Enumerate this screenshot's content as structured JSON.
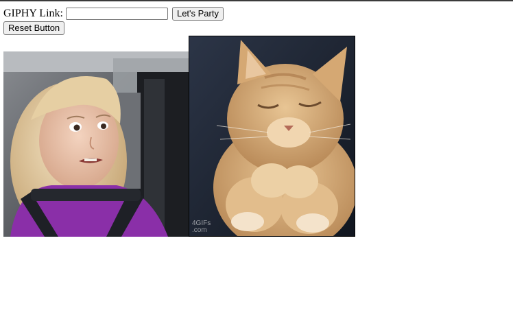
{
  "form": {
    "label": "GIPHY Link:",
    "input_value": "",
    "input_placeholder": "",
    "party_button": "Let's Party",
    "reset_button": "Reset Button"
  },
  "gifs": [
    {
      "subject": "young girl in car seat with skeptical face"
    },
    {
      "subject": "orange kitten with eyes closed and paws together",
      "watermark": "4GIFs\n.com"
    }
  ],
  "colors": {
    "button_bg": "#efefef",
    "button_border": "#767676",
    "page_bg": "#ffffff"
  }
}
